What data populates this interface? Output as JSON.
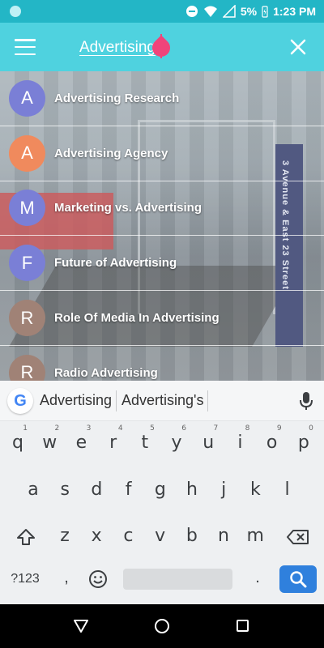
{
  "status_bar": {
    "battery_percent": "5%",
    "time": "1:23 PM"
  },
  "search": {
    "query": "Advertising"
  },
  "results": [
    {
      "initial": "A",
      "label": "Advertising Research",
      "color": "#7a7fd6"
    },
    {
      "initial": "A",
      "label": "Advertising Agency",
      "color": "#f08a5d"
    },
    {
      "initial": "M",
      "label": "Marketing vs. Advertising",
      "color": "#7a7fd6"
    },
    {
      "initial": "F",
      "label": "Future of Advertising",
      "color": "#7a7fd6"
    },
    {
      "initial": "R",
      "label": "Role Of Media In Advertising",
      "color": "#a08276"
    },
    {
      "initial": "R",
      "label": "Radio Advertising",
      "color": "#a08276"
    }
  ],
  "background_sign": "3 Avenue & East 23 Street",
  "keyboard": {
    "suggestions": [
      "Advertising",
      "Advertising's"
    ],
    "row1": [
      {
        "k": "q",
        "h": "1"
      },
      {
        "k": "w",
        "h": "2"
      },
      {
        "k": "e",
        "h": "3"
      },
      {
        "k": "r",
        "h": "4"
      },
      {
        "k": "t",
        "h": "5"
      },
      {
        "k": "y",
        "h": "6"
      },
      {
        "k": "u",
        "h": "7"
      },
      {
        "k": "i",
        "h": "8"
      },
      {
        "k": "o",
        "h": "9"
      },
      {
        "k": "p",
        "h": "0"
      }
    ],
    "row2": [
      "a",
      "s",
      "d",
      "f",
      "g",
      "h",
      "j",
      "k",
      "l"
    ],
    "row3": [
      "z",
      "x",
      "c",
      "v",
      "b",
      "n",
      "m"
    ],
    "symbols_label": "?123",
    "comma": ",",
    "period": "."
  },
  "colors": {
    "status_bar": "#23b6c6",
    "app_bar": "#4fd2df",
    "cursor": "#f0447a",
    "search_key": "#2f80dd"
  }
}
